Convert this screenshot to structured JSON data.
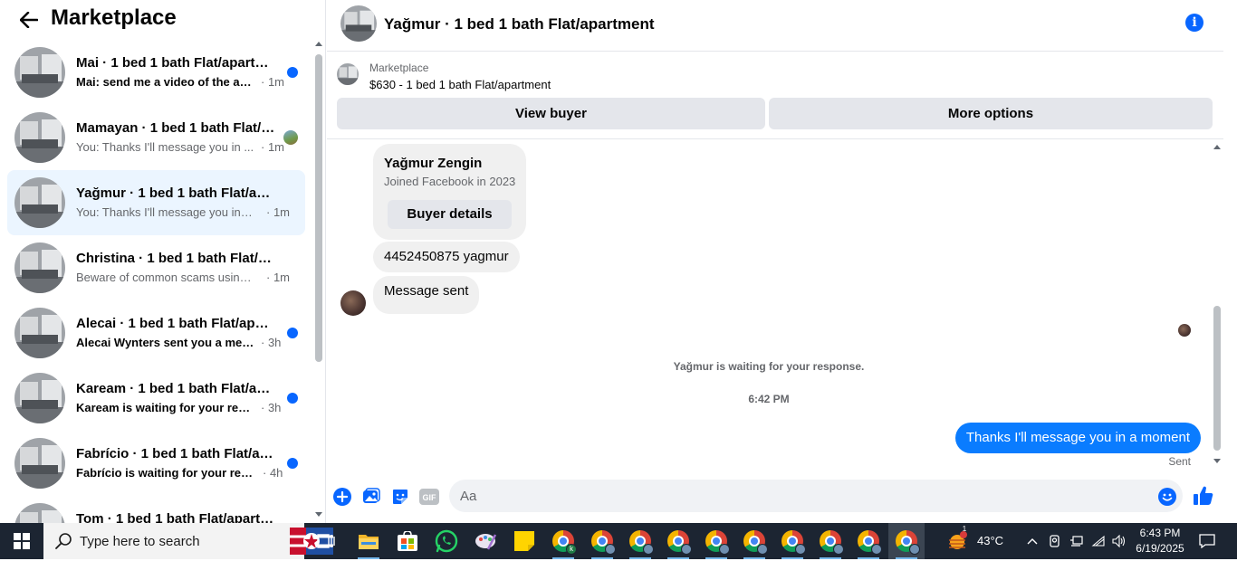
{
  "left_panel": {
    "title": "Marketplace",
    "conversations": [
      {
        "title": "Mai · 1 bed 1 bath Flat/apartm...",
        "preview": "Mai: send me a video of the ap...",
        "time": "· 1m",
        "unread": true
      },
      {
        "title": "Mamayan · 1 bed 1 bath Flat/a...",
        "preview": "You: Thanks I'll message you in ...",
        "time": "· 1m",
        "unread": false
      },
      {
        "title": "Yağmur · 1 bed 1 bath Flat/apart...",
        "preview": "You: Thanks I'll message you in a ...",
        "time": "· 1m",
        "unread": false,
        "active": true
      },
      {
        "title": "Christina · 1 bed 1 bath Flat/apar...",
        "preview": "Beware of common scams using p...",
        "time": "· 1m",
        "unread": false
      },
      {
        "title": "Alecai · 1 bed 1 bath Flat/apart...",
        "preview": "Alecai Wynters sent you a mess...",
        "time": "· 3h",
        "unread": true
      },
      {
        "title": "Kaream · 1 bed 1 bath Flat/apa...",
        "preview": "Kaream is waiting for your resp...",
        "time": "· 3h",
        "unread": true
      },
      {
        "title": "Fabrício · 1 bed 1 bath Flat/apa...",
        "preview": "Fabrício is waiting for your resp...",
        "time": "· 4h",
        "unread": true
      },
      {
        "title": "Tom · 1 bed 1 bath Flat/apartm...",
        "preview": "",
        "time": "",
        "unread": true
      }
    ]
  },
  "chat": {
    "header_title": "Yağmur · 1 bed 1 bath Flat/apartment",
    "listing_source": "Marketplace",
    "listing_title": "$630 - 1 bed 1 bath Flat/apartment",
    "view_buyer_label": "View buyer",
    "more_options_label": "More options",
    "buyer_name": "Yağmur Zengin",
    "buyer_joined": "Joined Facebook in 2023",
    "buyer_details_label": "Buyer details",
    "msg_phone": "4452450875 yagmur",
    "msg_sent": "Message sent",
    "waiting_text": "Yağmur is waiting for your response.",
    "timestamp": "6:42 PM",
    "outgoing_message": "Thanks I'll message you in a moment",
    "sent_status": "Sent",
    "input_placeholder": "Aa"
  },
  "taskbar": {
    "search_placeholder": "Type here to search",
    "temperature": "43°C",
    "weather_badge": "1",
    "time": "6:43 PM",
    "date": "6/19/2025",
    "chrome_badge": "k"
  },
  "colors": {
    "accent": "#0866ff",
    "outgoing_bubble": "#0a7cff",
    "active_row": "#ebf5ff",
    "taskbar": "#1c2532"
  }
}
